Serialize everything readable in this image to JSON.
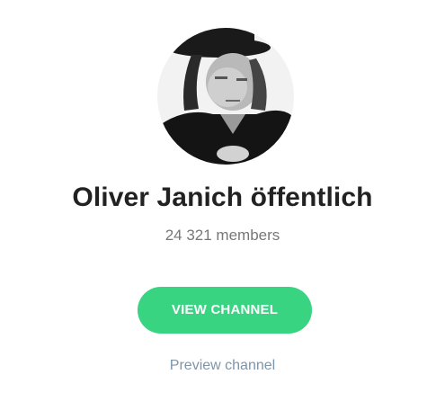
{
  "channel": {
    "title": "Oliver Janich öffentlich",
    "members": "24 321 members",
    "avatar_icon": "channel-avatar-photo"
  },
  "actions": {
    "view_label": "VIEW CHANNEL",
    "preview_label": "Preview channel"
  },
  "colors": {
    "accent": "#39d482",
    "link": "#7e95a8",
    "title": "#222222",
    "subtitle": "#777777"
  }
}
